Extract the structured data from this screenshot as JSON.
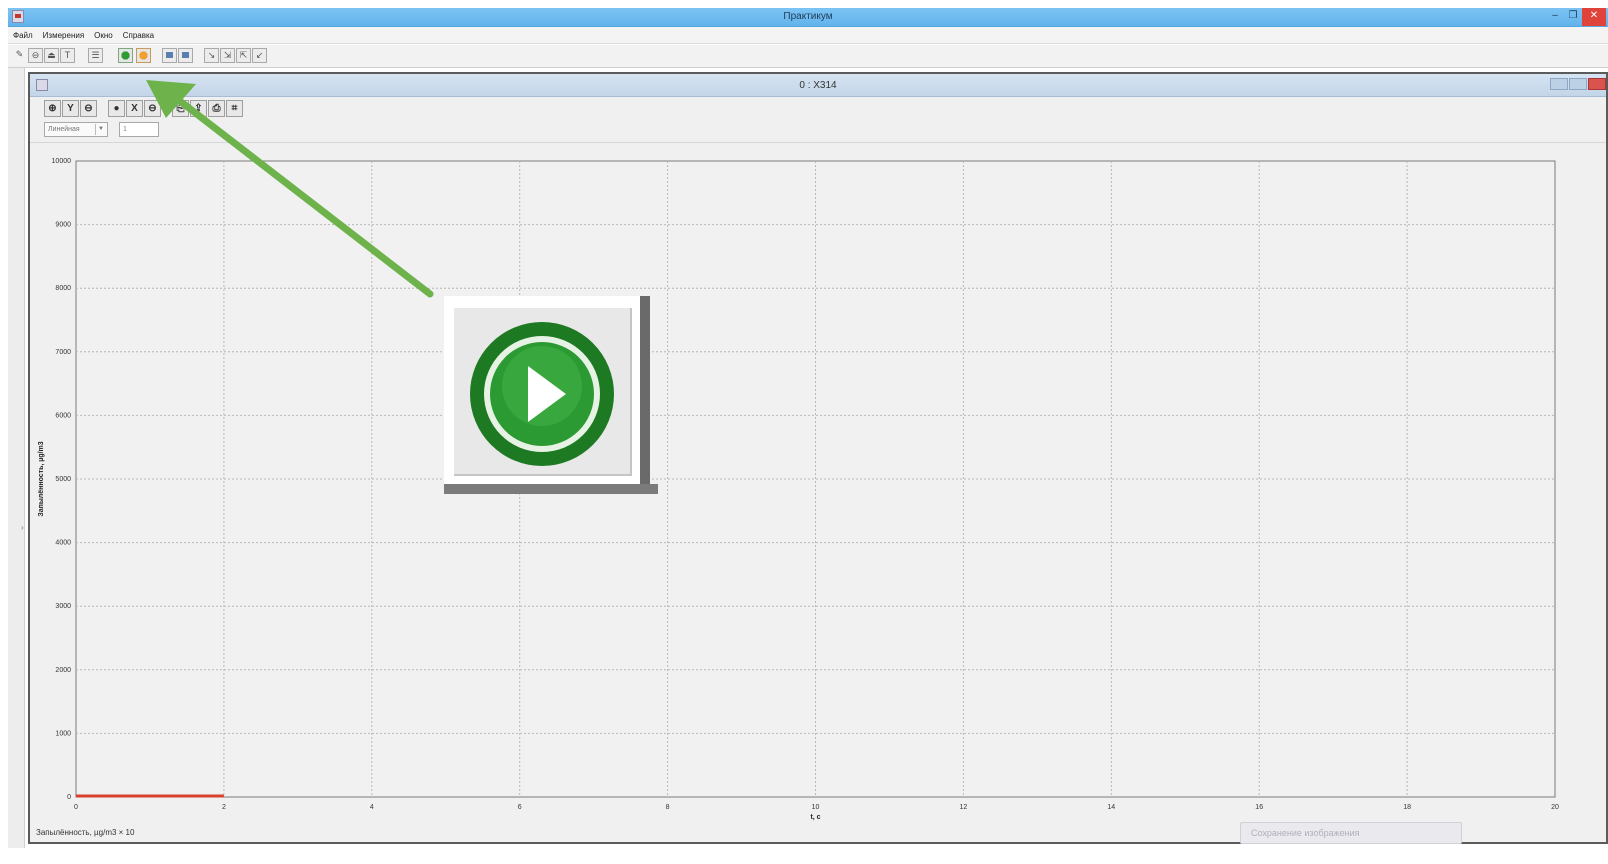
{
  "app": {
    "title": "Практикум",
    "controls": {
      "minimize": "–",
      "restore": "❐",
      "close": "✕"
    }
  },
  "menu": {
    "items": [
      "Файл",
      "Измерения",
      "Окно",
      "Справка"
    ]
  },
  "child_window": {
    "title": "0 : X314"
  },
  "scale_mode": "Линейная",
  "scale_value": "1",
  "chart_data": {
    "type": "line",
    "xlabel": "t, c",
    "ylabel": "Запылённость, µg/m3",
    "xlim": [
      0,
      20
    ],
    "ylim": [
      0,
      10000
    ],
    "xticks": [
      0,
      2,
      4,
      6,
      8,
      10,
      12,
      14,
      16,
      18,
      20
    ],
    "yticks": [
      0,
      1000,
      2000,
      3000,
      4000,
      5000,
      6000,
      7000,
      8000,
      9000,
      10000
    ],
    "grid": true,
    "series": [
      {
        "x": [
          0,
          2
        ],
        "y": [
          0,
          0
        ],
        "color": "#d9402f"
      }
    ]
  },
  "status": {
    "text": "Запылённость, µg/m3 × 10"
  },
  "notification": {
    "text": "Сохранение изображения"
  },
  "colors": {
    "accent_arrow": "#6db24a",
    "play_green": "#1f8a2a",
    "titlebar": "#6bb8ee"
  },
  "icons": {
    "toolbar": [
      "pen-icon",
      "probe-icon",
      "settings-icon",
      "text-icon",
      "table-icon",
      "start-icon",
      "stop-icon",
      "monitor-icon",
      "display-icon",
      "chart1-icon",
      "chart2-icon",
      "chart3-icon",
      "chart4-icon"
    ],
    "child_toolbar": [
      "y-zoom-icon",
      "y-axis-icon",
      "y-reset-icon",
      "x-zoom-icon",
      "x-axis-icon",
      "x-reset-icon",
      "copy-icon",
      "export-icon",
      "print-icon",
      "save-icon"
    ]
  }
}
